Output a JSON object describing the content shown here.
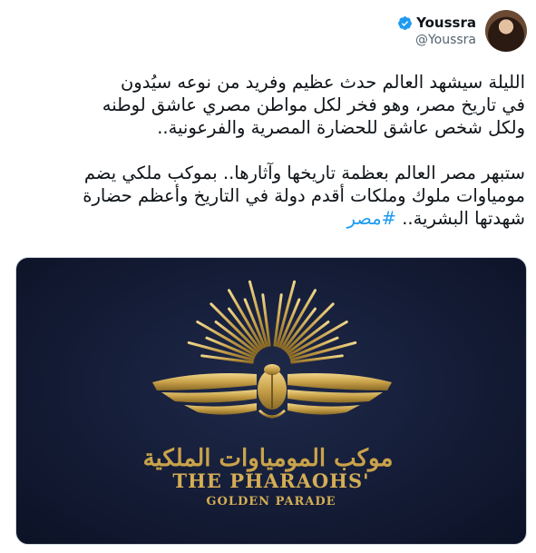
{
  "author": {
    "display_name": "Youssra",
    "handle": "@Youssra",
    "verified": true
  },
  "tweet": {
    "paragraph_1_lines": [
      "الليلة سيشهد العالم حدث عظيم وفريد من نوعه سيُدون",
      "في تاريخ مصر، وهو فخر لكل مواطن مصري عاشق لوطنه",
      "ولكل شخص عاشق للحضارة المصرية والفرعونية.."
    ],
    "paragraph_2_lines": [
      "ستبهر مصر العالم بعظمة تاريخها وآثارها.. بموكب ملكي يضم",
      "مومياوات  ملوك وملكات أقدم دولة في التاريخ وأعظم حضارة",
      "شهدتها البشرية.."
    ],
    "hashtag": "#مصر"
  },
  "media": {
    "arabic_logo_text": "موكب المومياوات الملكية",
    "title_line_1": "THE PHARAOHS'",
    "title_line_2": "GOLDEN PARADE",
    "colors": {
      "background": "#141c36",
      "gold": "#d4ad55"
    },
    "icon": "golden-winged-scarab-emblem"
  },
  "colors": {
    "link": "#1d9bf0",
    "verified_badge": "#1d9bf0",
    "secondary_text": "#536471"
  }
}
